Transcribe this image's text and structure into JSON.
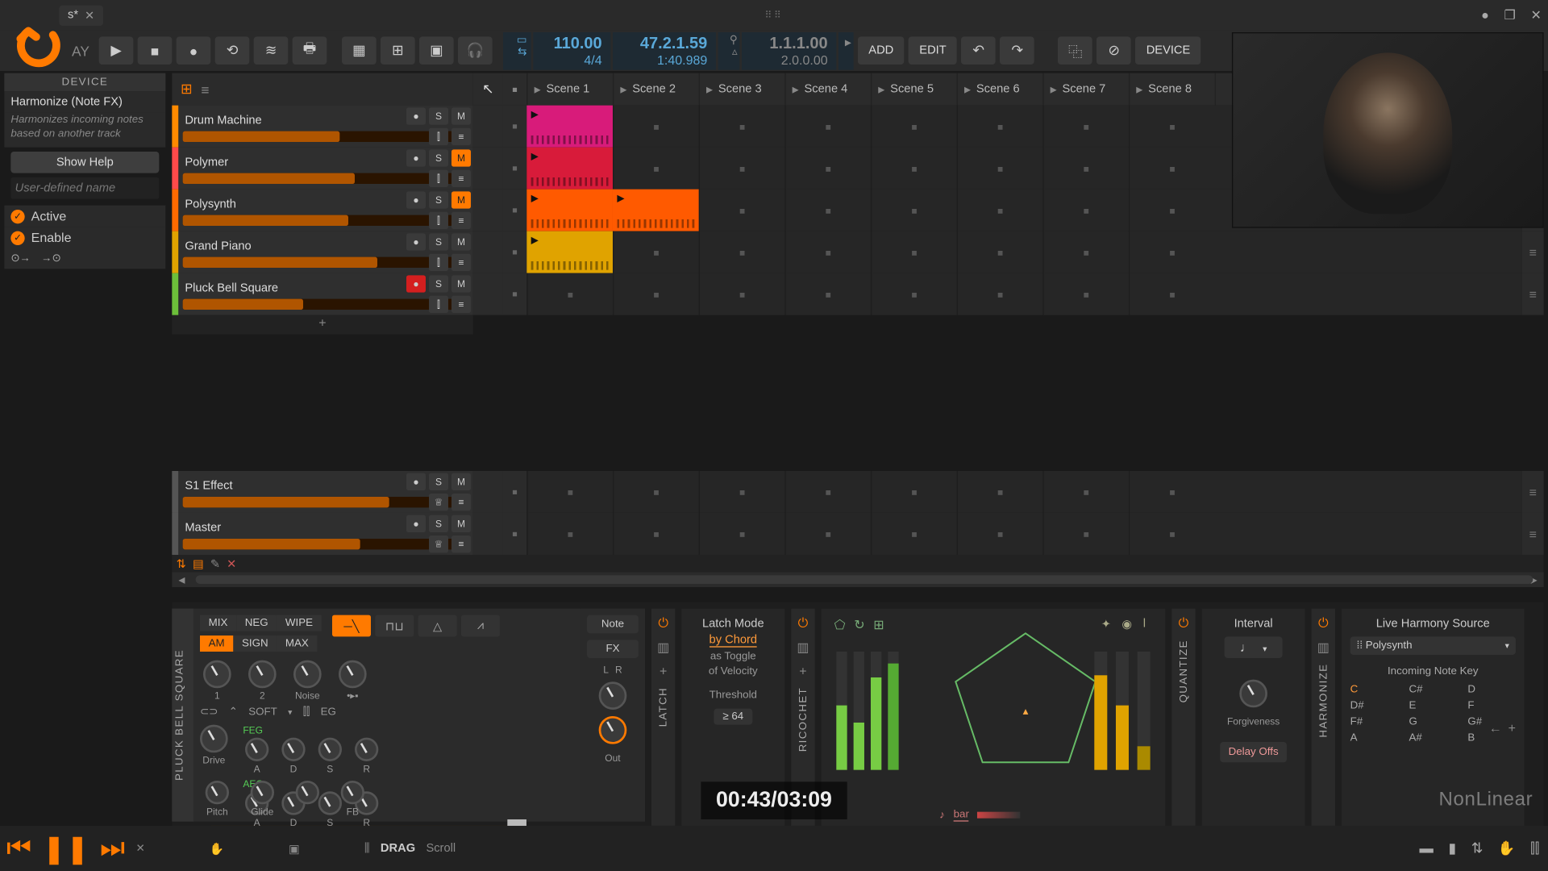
{
  "titlebar": {
    "tab": "s*",
    "close": "✕"
  },
  "toolbar": {
    "play_label": "AY",
    "tempo": "110.00",
    "sig": "4/4",
    "bars": "47.2.1.59",
    "time": "1:40.989",
    "loop_start": "1.1.1.00",
    "loop_len": "2.0.0.00",
    "add": "ADD",
    "edit": "EDIT",
    "device_btn": "DEVICE"
  },
  "device": {
    "header": "DEVICE",
    "title": "Harmonize (Note FX)",
    "desc": "Harmonizes incoming notes based on another track",
    "help": "Show Help",
    "placeholder": "User-defined name",
    "active": "Active",
    "enable": "Enable"
  },
  "scenes": [
    "Scene 1",
    "Scene 2",
    "Scene 3",
    "Scene 4",
    "Scene 5",
    "Scene 6",
    "Scene 7",
    "Scene 8"
  ],
  "tracks": [
    {
      "name": "Drum Machine",
      "color": "#ff8a00",
      "mute": false,
      "fill": 55,
      "fillcolor": "#b05500"
    },
    {
      "name": "Polymer",
      "color": "#ff4a4a",
      "mute": true,
      "fill": 60,
      "fillcolor": "#b05500"
    },
    {
      "name": "Polysynth",
      "color": "#ff6a00",
      "mute": true,
      "fill": 58,
      "fillcolor": "#b05500"
    },
    {
      "name": "Grand Piano",
      "color": "#e0a300",
      "mute": false,
      "fill": 68,
      "fillcolor": "#b05500"
    },
    {
      "name": "Pluck Bell Square",
      "color": "#6cbf3a",
      "rec": true,
      "fill": 42,
      "fillcolor": "#b05500"
    }
  ],
  "effect_tracks": [
    {
      "name": "S1 Effect",
      "fill": 72
    },
    {
      "name": "Master",
      "fill": 62
    }
  ],
  "clips": {
    "0": [
      {
        "slot": 0,
        "color": "#d81b7a",
        "hasPlay": true
      }
    ],
    "1": [
      {
        "slot": 0,
        "color": "#d81b3a",
        "hasPlay": true
      }
    ],
    "2": [
      {
        "slot": 0,
        "color": "#ff5a00",
        "hasPlay": true
      },
      {
        "slot": 1,
        "color": "#ff5a00",
        "hasPlay": true
      }
    ],
    "3": [
      {
        "slot": 0,
        "color": "#e0a300",
        "hasPlay": true
      }
    ]
  },
  "synth": {
    "label": "PLUCK BELL SQUARE",
    "seg1": [
      "MIX",
      "NEG",
      "WIPE"
    ],
    "seg2": [
      "AM",
      "SIGN",
      "MAX"
    ],
    "knobs1": [
      "1",
      "2",
      "Noise",
      "•▸▪"
    ],
    "knobs_drive": "Drive",
    "soft": "SOFT",
    "feg": "FEG",
    "aeg": "AEG",
    "adsr": [
      "A",
      "D",
      "S",
      "R"
    ],
    "bottom": [
      "Pitch",
      "Glide",
      "",
      "FB"
    ],
    "out": "Out",
    "side": [
      "Note",
      "FX",
      "L",
      "R"
    ]
  },
  "latch": {
    "head": "Latch Mode",
    "mode": "by Chord",
    "l1": "as Toggle",
    "l2": "of Velocity",
    "th_label": "Threshold",
    "th": "≥ 64",
    "side": "LATCH"
  },
  "ricochet": {
    "side": "RICOCHET",
    "foot": "bar"
  },
  "quantize": {
    "side": "QUANTIZE",
    "head": "Interval",
    "note": "♩",
    "forg": "Forgiveness",
    "delay": "Delay Offs"
  },
  "harmonize": {
    "side": "HARMONIZE",
    "head": "Live Harmony Source",
    "src": "⁞⁞ Polysynth",
    "sub": "Incoming Note Key",
    "keys": [
      "C",
      "C#",
      "D",
      "D#",
      "E",
      "F",
      "F#",
      "G",
      "G#",
      "A",
      "A#",
      "B"
    ]
  },
  "footer": {
    "time": "00:43/03:09",
    "drag": "DRAG",
    "scroll": "Scroll",
    "progress_pct": 23
  },
  "watermark": "NonLinear"
}
